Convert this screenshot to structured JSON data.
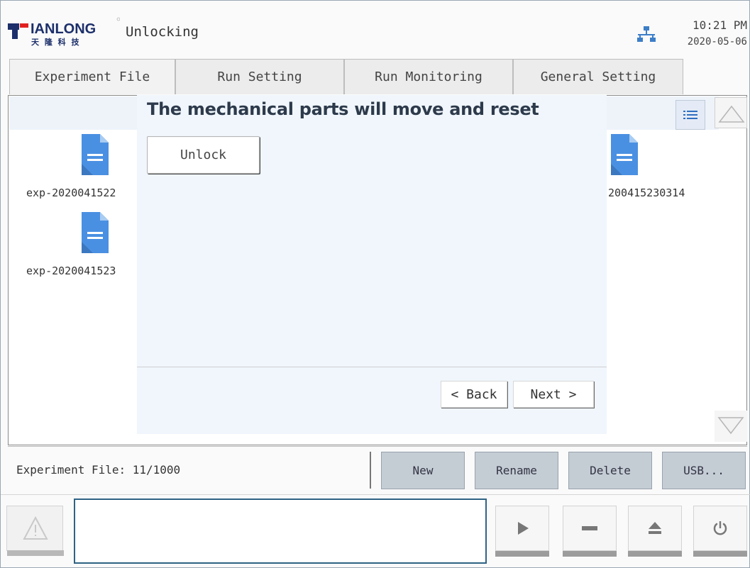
{
  "header": {
    "brand_text": "IANLONG",
    "brand_sub": "天 隆 科 技",
    "title": "Unlocking",
    "time": "10:21 PM",
    "date": "2020-05-06"
  },
  "tabs": [
    {
      "label": "Experiment File",
      "active": true
    },
    {
      "label": "Run Setting",
      "active": false
    },
    {
      "label": "Run Monitoring",
      "active": false
    },
    {
      "label": "General Setting",
      "active": false
    }
  ],
  "files": [
    {
      "label": "exp-2020041522"
    },
    {
      "label": "exp-2020041523"
    },
    {
      "label": "200415230314"
    }
  ],
  "wizard": {
    "heading": "The mechanical parts will move and reset",
    "unlock_label": "Unlock",
    "back_label": "< Back",
    "next_label": "Next >"
  },
  "toolbar": {
    "status": "Experiment File: 11/1000",
    "new_label": "New",
    "rename_label": "Rename",
    "delete_label": "Delete",
    "usb_label": "USB..."
  },
  "icons": {
    "warning": "warning-icon",
    "play": "play-icon",
    "stop": "stop-icon",
    "eject": "eject-icon",
    "power": "power-icon",
    "network": "network-icon",
    "list": "list-view-icon",
    "file": "document-icon"
  },
  "colors": {
    "accent_blue": "#4a90e2",
    "logo_red": "#e02020",
    "logo_navy": "#1c2f6b",
    "toolbar_button": "#c4ccd4",
    "message_border": "#2e6384"
  }
}
